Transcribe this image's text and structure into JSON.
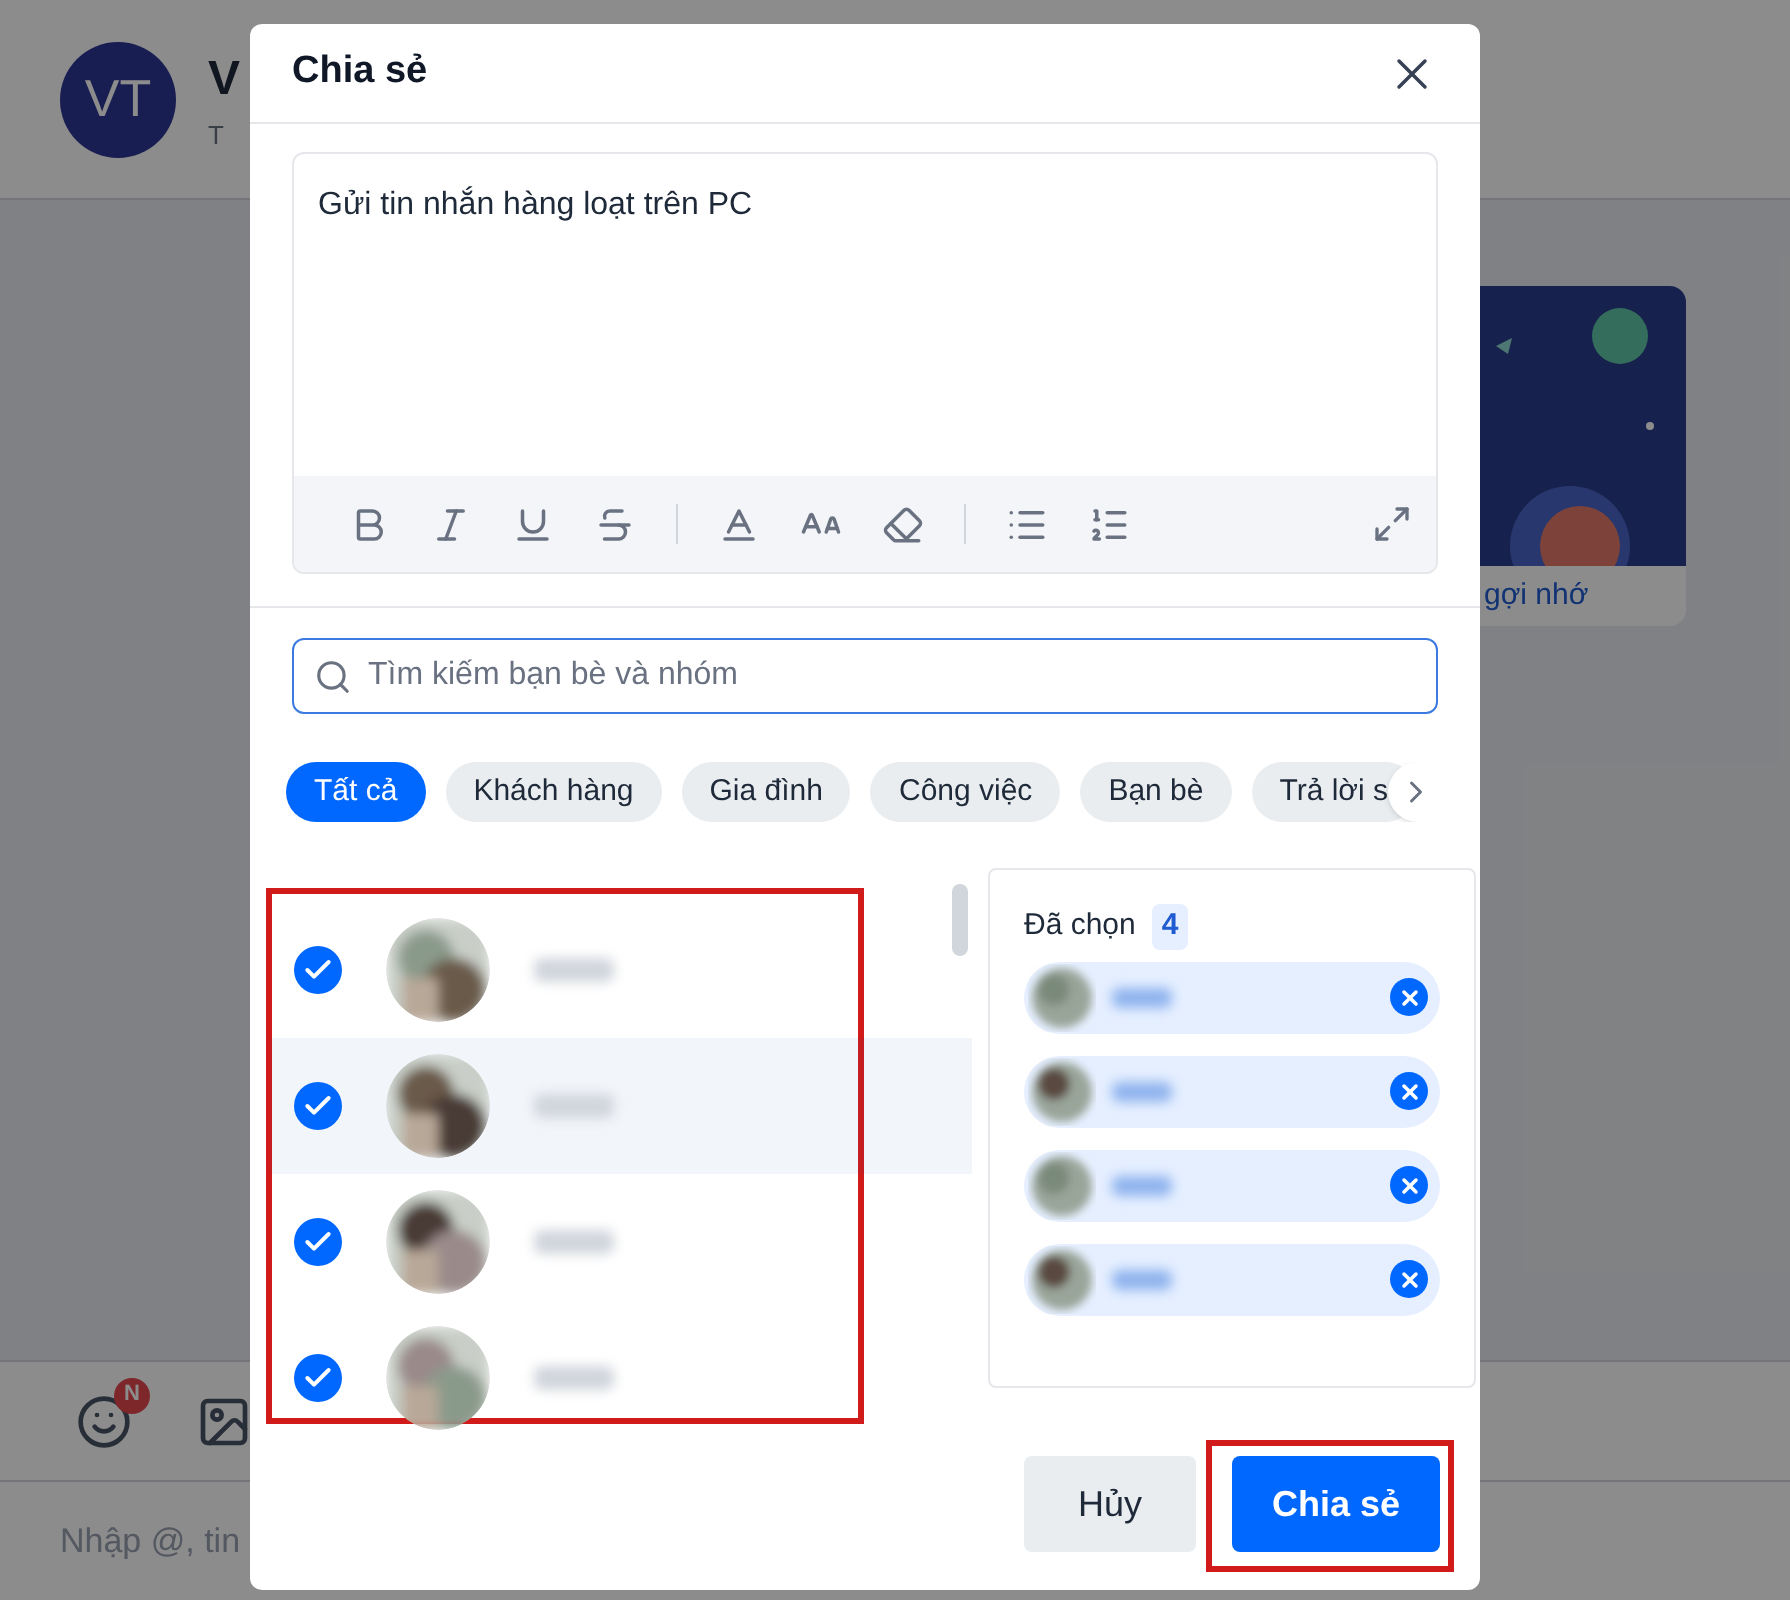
{
  "background": {
    "avatar_initials": "VT",
    "title": "V",
    "subtitle": "T",
    "card_caption": "gợi nhớ",
    "emoji_badge": "N",
    "composer_placeholder": "Nhập @, tin"
  },
  "dialog": {
    "title": "Chia sẻ",
    "message": "Gửi tin nhắn hàng loạt trên PC",
    "search": {
      "placeholder": "Tìm kiếm bạn bè và nhóm"
    },
    "filters": [
      {
        "label": "Tất cả",
        "selected": true
      },
      {
        "label": "Khách hàng",
        "selected": false
      },
      {
        "label": "Gia đình",
        "selected": false
      },
      {
        "label": "Công việc",
        "selected": false
      },
      {
        "label": "Bạn bè",
        "selected": false
      },
      {
        "label": "Trả lời s",
        "selected": false
      }
    ],
    "contacts": [
      {
        "checked": true,
        "hovered": false
      },
      {
        "checked": true,
        "hovered": true
      },
      {
        "checked": true,
        "hovered": false
      },
      {
        "checked": true,
        "hovered": false
      }
    ],
    "selected_panel": {
      "label": "Đã chọn",
      "count": "4",
      "items": [
        {
          "kind": "chip"
        },
        {
          "kind": "chip"
        },
        {
          "kind": "chip"
        },
        {
          "kind": "chip"
        }
      ]
    },
    "buttons": {
      "cancel": "Hủy",
      "confirm": "Chia sẻ"
    }
  }
}
